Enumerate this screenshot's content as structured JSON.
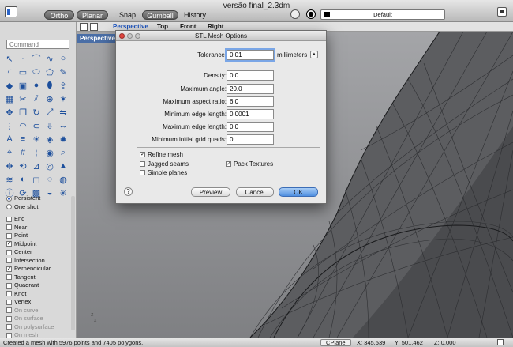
{
  "window": {
    "title": "versão final_2.3dm"
  },
  "toolbar": {
    "ortho": "Ortho",
    "planar": "Planar",
    "snap": "Snap",
    "gumball": "Gumball",
    "history": "History",
    "display_mode": "Default"
  },
  "sidebar": {
    "command_placeholder": "Command",
    "tool_icons": [
      "arrow",
      "point",
      "polyline",
      "curve",
      "circle",
      "arc",
      "rectangle",
      "ellipse",
      "polygon",
      "freeform",
      "surface",
      "box",
      "sphere",
      "cylinder",
      "extrude",
      "mesh",
      "trim",
      "split",
      "join",
      "explode",
      "move",
      "copy",
      "rotate",
      "scale",
      "mirror",
      "array",
      "fillet",
      "offset",
      "project",
      "dimension",
      "text",
      "layer",
      "render",
      "material",
      "light",
      "camera",
      "grid",
      "snap",
      "record",
      "zoom",
      "pan",
      "orbit",
      "analyze",
      "curvature",
      "draft",
      "zebra",
      "shade",
      "wire",
      "ghost",
      "xray",
      "properties",
      "history",
      "texture",
      "emap",
      "grasshopper"
    ],
    "osnap_mode": [
      {
        "label": "Persistent",
        "selected": true
      },
      {
        "label": "One shot",
        "selected": false
      }
    ],
    "osnaps": [
      {
        "label": "End",
        "checked": false,
        "enabled": true
      },
      {
        "label": "Near",
        "checked": false,
        "enabled": true
      },
      {
        "label": "Point",
        "checked": false,
        "enabled": true
      },
      {
        "label": "Midpoint",
        "checked": true,
        "enabled": true
      },
      {
        "label": "Center",
        "checked": false,
        "enabled": true
      },
      {
        "label": "Intersection",
        "checked": false,
        "enabled": true
      },
      {
        "label": "Perpendicular",
        "checked": true,
        "enabled": true
      },
      {
        "label": "Tangent",
        "checked": false,
        "enabled": true
      },
      {
        "label": "Quadrant",
        "checked": false,
        "enabled": true
      },
      {
        "label": "Knot",
        "checked": false,
        "enabled": true
      },
      {
        "label": "Vertex",
        "checked": false,
        "enabled": true
      },
      {
        "label": "On curve",
        "checked": false,
        "enabled": false
      },
      {
        "label": "On surface",
        "checked": false,
        "enabled": false
      },
      {
        "label": "On polysurface",
        "checked": false,
        "enabled": false
      },
      {
        "label": "On mesh",
        "checked": false,
        "enabled": false
      }
    ]
  },
  "viewport_tabs": [
    "Perspective",
    "Top",
    "Front",
    "Right"
  ],
  "viewport": {
    "label": "Perspective",
    "axis_x": "x",
    "axis_z": "z"
  },
  "dialog": {
    "title": "STL Mesh Options",
    "tolerance_label": "Tolerance:",
    "tolerance_value": "0.01",
    "tolerance_unit": "millimeters",
    "fields": [
      {
        "label": "Density:",
        "value": "0.0"
      },
      {
        "label": "Maximum angle:",
        "value": "20.0"
      },
      {
        "label": "Maximum aspect ratio:",
        "value": "6.0"
      },
      {
        "label": "Minimum edge length:",
        "value": "0.0001"
      },
      {
        "label": "Maximum edge length:",
        "value": "0.0"
      },
      {
        "label": "Minimum initial grid quads:",
        "value": "0"
      }
    ],
    "checks": [
      {
        "label": "Refine mesh",
        "checked": true
      },
      {
        "label": "Jagged seams",
        "checked": false
      },
      {
        "label": "Simple planes",
        "checked": false
      },
      {
        "label": "Pack Textures",
        "checked": true
      }
    ],
    "help": "?",
    "preview": "Preview",
    "cancel": "Cancel",
    "ok": "OK"
  },
  "status": {
    "message": "Created a mesh with 5976 points and 7405 polygons.",
    "cplane": "CPlane",
    "x": "X: 345.539",
    "y": "Y: 501.462",
    "z": "Z: 0.000"
  }
}
